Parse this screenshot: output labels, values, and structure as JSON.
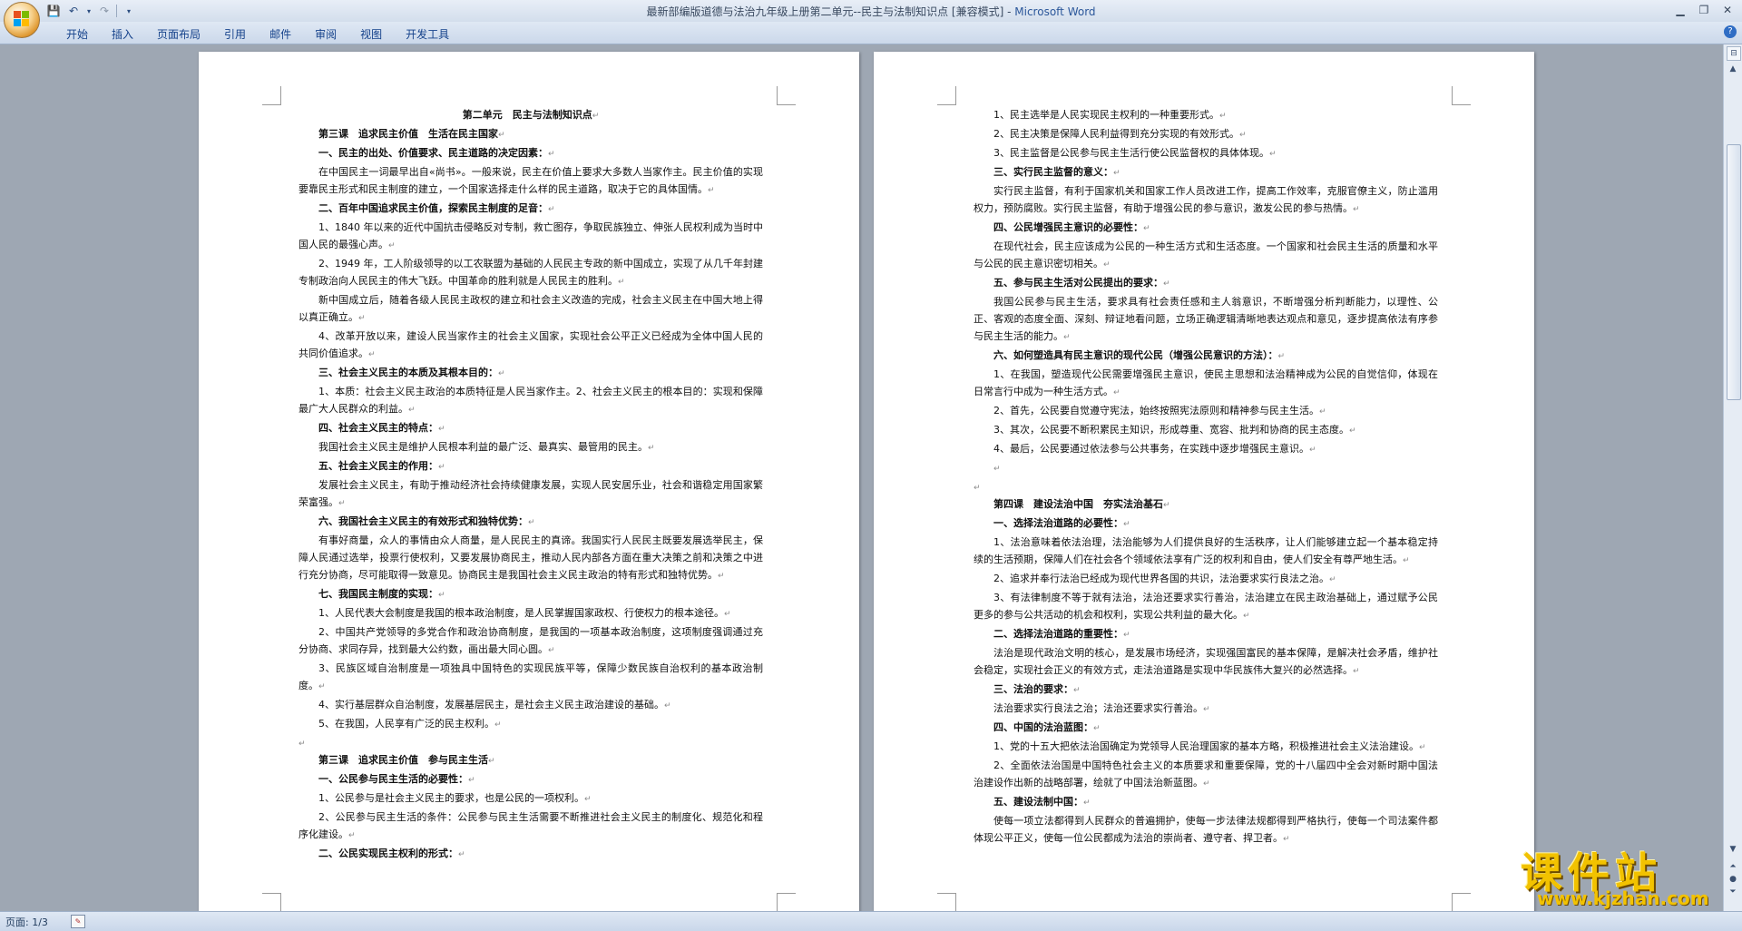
{
  "window": {
    "title": "最新部编版道德与法治九年级上册第二单元--民主与法制知识点 [兼容模式] - ",
    "app_name": "Microsoft Word"
  },
  "ribbon": {
    "tabs": [
      "开始",
      "插入",
      "页面布局",
      "引用",
      "邮件",
      "审阅",
      "视图",
      "开发工具"
    ]
  },
  "status": {
    "page": "页面: 1/3"
  },
  "watermark": {
    "title": "课件站",
    "url": "www.kjzhan.com"
  },
  "colors": {
    "ribbon_text": "#15428b",
    "workspace": "#9ea7b3",
    "watermark": "#f2c200"
  },
  "page_left": [
    {
      "t": "center",
      "text": "第二单元　民主与法制知识点"
    },
    {
      "t": "lesson",
      "text": "第三课　追求民主价值　生活在民主国家"
    },
    {
      "t": "h",
      "text": "一、民主的出处、价值要求、民主道路的决定因素："
    },
    {
      "t": "ind",
      "text": "在中国民主一词最早出自«尚书»。一般来说，民主在价值上要求大多数人当家作主。民主价值的实现要靠民主形式和民主制度的建立，一个国家选择走什么样的民主道路，取决于它的具体国情。"
    },
    {
      "t": "h",
      "text": "二、百年中国追求民主价值，探索民主制度的足音："
    },
    {
      "t": "ind",
      "text": "1、1840 年以来的近代中国抗击侵略反对专制，救亡图存，争取民族独立、伸张人民权利成为当时中国人民的最强心声。"
    },
    {
      "t": "ind",
      "text": "2、1949 年，工人阶级领导的以工农联盟为基础的人民民主专政的新中国成立，实现了从几千年封建专制政治向人民民主的伟大飞跃。中国革命的胜利就是人民民主的胜利。"
    },
    {
      "t": "ind",
      "text": "新中国成立后，随着各级人民民主政权的建立和社会主义改造的完成，社会主义民主在中国大地上得以真正确立。"
    },
    {
      "t": "ind",
      "text": "4、改革开放以来，建设人民当家作主的社会主义国家，实现社会公平正义已经成为全体中国人民的共同价值追求。"
    },
    {
      "t": "h",
      "text": "三、社会主义民主的本质及其根本目的："
    },
    {
      "t": "ind",
      "text": "1、本质：社会主义民主政治的本质特征是人民当家作主。2、社会主义民主的根本目的：实现和保障最广大人民群众的利益。"
    },
    {
      "t": "h",
      "text": "四、社会主义民主的特点："
    },
    {
      "t": "ind",
      "text": "我国社会主义民主是维护人民根本利益的最广泛、最真实、最管用的民主。"
    },
    {
      "t": "h",
      "text": "五、社会主义民主的作用："
    },
    {
      "t": "ind",
      "text": "发展社会主义民主，有助于推动经济社会持续健康发展，实现人民安居乐业，社会和谐稳定用国家繁荣富强。"
    },
    {
      "t": "h",
      "text": "六、我国社会主义民主的有效形式和独特优势："
    },
    {
      "t": "ind",
      "text": "有事好商量，众人的事情由众人商量，是人民民主的真谛。我国实行人民民主既要发展选举民主，保障人民通过选举，投票行使权利，又要发展协商民主，推动人民内部各方面在重大决策之前和决策之中进行充分协商，尽可能取得一致意见。协商民主是我国社会主义民主政治的特有形式和独特优势。"
    },
    {
      "t": "h",
      "text": "七、我国民主制度的实现："
    },
    {
      "t": "ind",
      "text": "1、人民代表大会制度是我国的根本政治制度，是人民掌握国家政权、行使权力的根本途径。"
    },
    {
      "t": "ind",
      "text": "2、中国共产党领导的多党合作和政治协商制度，是我国的一项基本政治制度，这项制度强调通过充分协商、求同存异，找到最大公约数，画出最大同心圆。"
    },
    {
      "t": "ind",
      "text": "3、民族区域自治制度是一项独具中国特色的实现民族平等，保障少数民族自治权利的基本政治制度。"
    },
    {
      "t": "ind",
      "text": "4、实行基层群众自治制度，发展基层民主，是社会主义民主政治建设的基础。"
    },
    {
      "t": "ind",
      "text": "5、在我国，人民享有广泛的民主权利。"
    },
    {
      "t": "empty",
      "text": ""
    },
    {
      "t": "lesson",
      "text": "第三课　追求民主价值　参与民主生活"
    },
    {
      "t": "h",
      "text": "一、公民参与民主生活的必要性："
    },
    {
      "t": "ind",
      "text": "1、公民参与是社会主义民主的要求，也是公民的一项权利。"
    },
    {
      "t": "ind",
      "text": "2、公民参与民主生活的条件：公民参与民主生活需要不断推进社会主义民主的制度化、规范化和程序化建设。"
    },
    {
      "t": "h",
      "text": "二、公民实现民主权利的形式："
    }
  ],
  "page_right": [
    {
      "t": "ind",
      "text": "1、民主选举是人民实现民主权利的一种重要形式。"
    },
    {
      "t": "ind",
      "text": "2、民主决策是保障人民利益得到充分实现的有效形式。"
    },
    {
      "t": "ind",
      "text": "3、民主监督是公民参与民主生活行使公民监督权的具体体现。"
    },
    {
      "t": "h",
      "text": "三、实行民主监督的意义："
    },
    {
      "t": "ind",
      "text": "实行民主监督，有利于国家机关和国家工作人员改进工作，提高工作效率，克服官僚主义，防止滥用权力，预防腐败。实行民主监督，有助于增强公民的参与意识，激发公民的参与热情。"
    },
    {
      "t": "h",
      "text": "四、公民增强民主意识的必要性："
    },
    {
      "t": "ind",
      "text": "在现代社会，民主应该成为公民的一种生活方式和生活态度。一个国家和社会民主生活的质量和水平与公民的民主意识密切相关。"
    },
    {
      "t": "h",
      "text": "五、参与民主生活对公民提出的要求："
    },
    {
      "t": "ind",
      "text": "我国公民参与民主生活，要求具有社会责任感和主人翁意识，不断增强分析判断能力，以理性、公正、客观的态度全面、深刻、辩证地看问题，立场正确逻辑清晰地表达观点和意见，逐步提高依法有序参与民主生活的能力。"
    },
    {
      "t": "h",
      "text": "六、如何塑造具有民主意识的现代公民（增强公民意识的方法）："
    },
    {
      "t": "ind",
      "text": "1、在我国，塑造现代公民需要增强民主意识，使民主思想和法治精神成为公民的自觉信仰，体现在日常言行中成为一种生活方式。"
    },
    {
      "t": "ind",
      "text": "2、首先，公民要自觉遵守宪法，始终按照宪法原则和精神参与民主生活。"
    },
    {
      "t": "ind",
      "text": "3、其次，公民要不断积累民主知识，形成尊重、宽容、批判和协商的民主态度。"
    },
    {
      "t": "ind",
      "text": "4、最后，公民要通过依法参与公共事务，在实践中逐步增强民主意识。"
    },
    {
      "t": "ind",
      "text": ""
    },
    {
      "t": "empty",
      "text": ""
    },
    {
      "t": "lesson",
      "text": "第四课　建设法治中国　夯实法治基石"
    },
    {
      "t": "h",
      "text": "一、选择法治道路的必要性："
    },
    {
      "t": "ind",
      "text": "1、法治意味着依法治理，法治能够为人们提供良好的生活秩序，让人们能够建立起一个基本稳定持续的生活预期，保障人们在社会各个领域依法享有广泛的权利和自由，使人们安全有尊严地生活。"
    },
    {
      "t": "ind",
      "text": "2、追求并奉行法治已经成为现代世界各国的共识，法治要求实行良法之治。"
    },
    {
      "t": "ind",
      "text": "3、有法律制度不等于就有法治，法治还要求实行善治，法治建立在民主政治基础上，通过赋予公民更多的参与公共活动的机会和权利，实现公共利益的最大化。"
    },
    {
      "t": "h",
      "text": "二、选择法治道路的重要性："
    },
    {
      "t": "ind",
      "text": "法治是现代政治文明的核心，是发展市场经济，实现强国富民的基本保障，是解决社会矛盾，维护社会稳定，实现社会正义的有效方式，走法治道路是实现中华民族伟大复兴的必然选择。"
    },
    {
      "t": "h",
      "text": "三、法治的要求："
    },
    {
      "t": "ind",
      "text": "法治要求实行良法之治；法治还要求实行善治。"
    },
    {
      "t": "h",
      "text": "四、中国的法治蓝图："
    },
    {
      "t": "ind",
      "text": "1、党的十五大把依法治国确定为党领导人民治理国家的基本方略，积极推进社会主义法治建设。"
    },
    {
      "t": "ind",
      "text": "2、全面依法治国是中国特色社会主义的本质要求和重要保障，党的十八届四中全会对新时期中国法治建设作出新的战略部署，绘就了中国法治新蓝图。"
    },
    {
      "t": "h",
      "text": "五、建设法制中国："
    },
    {
      "t": "ind",
      "text": "使每一项立法都得到人民群众的普遍拥护，使每一步法律法规都得到严格执行，使每一个司法案件都体现公平正义，使每一位公民都成为法治的崇尚者、遵守者、捍卫者。"
    }
  ]
}
